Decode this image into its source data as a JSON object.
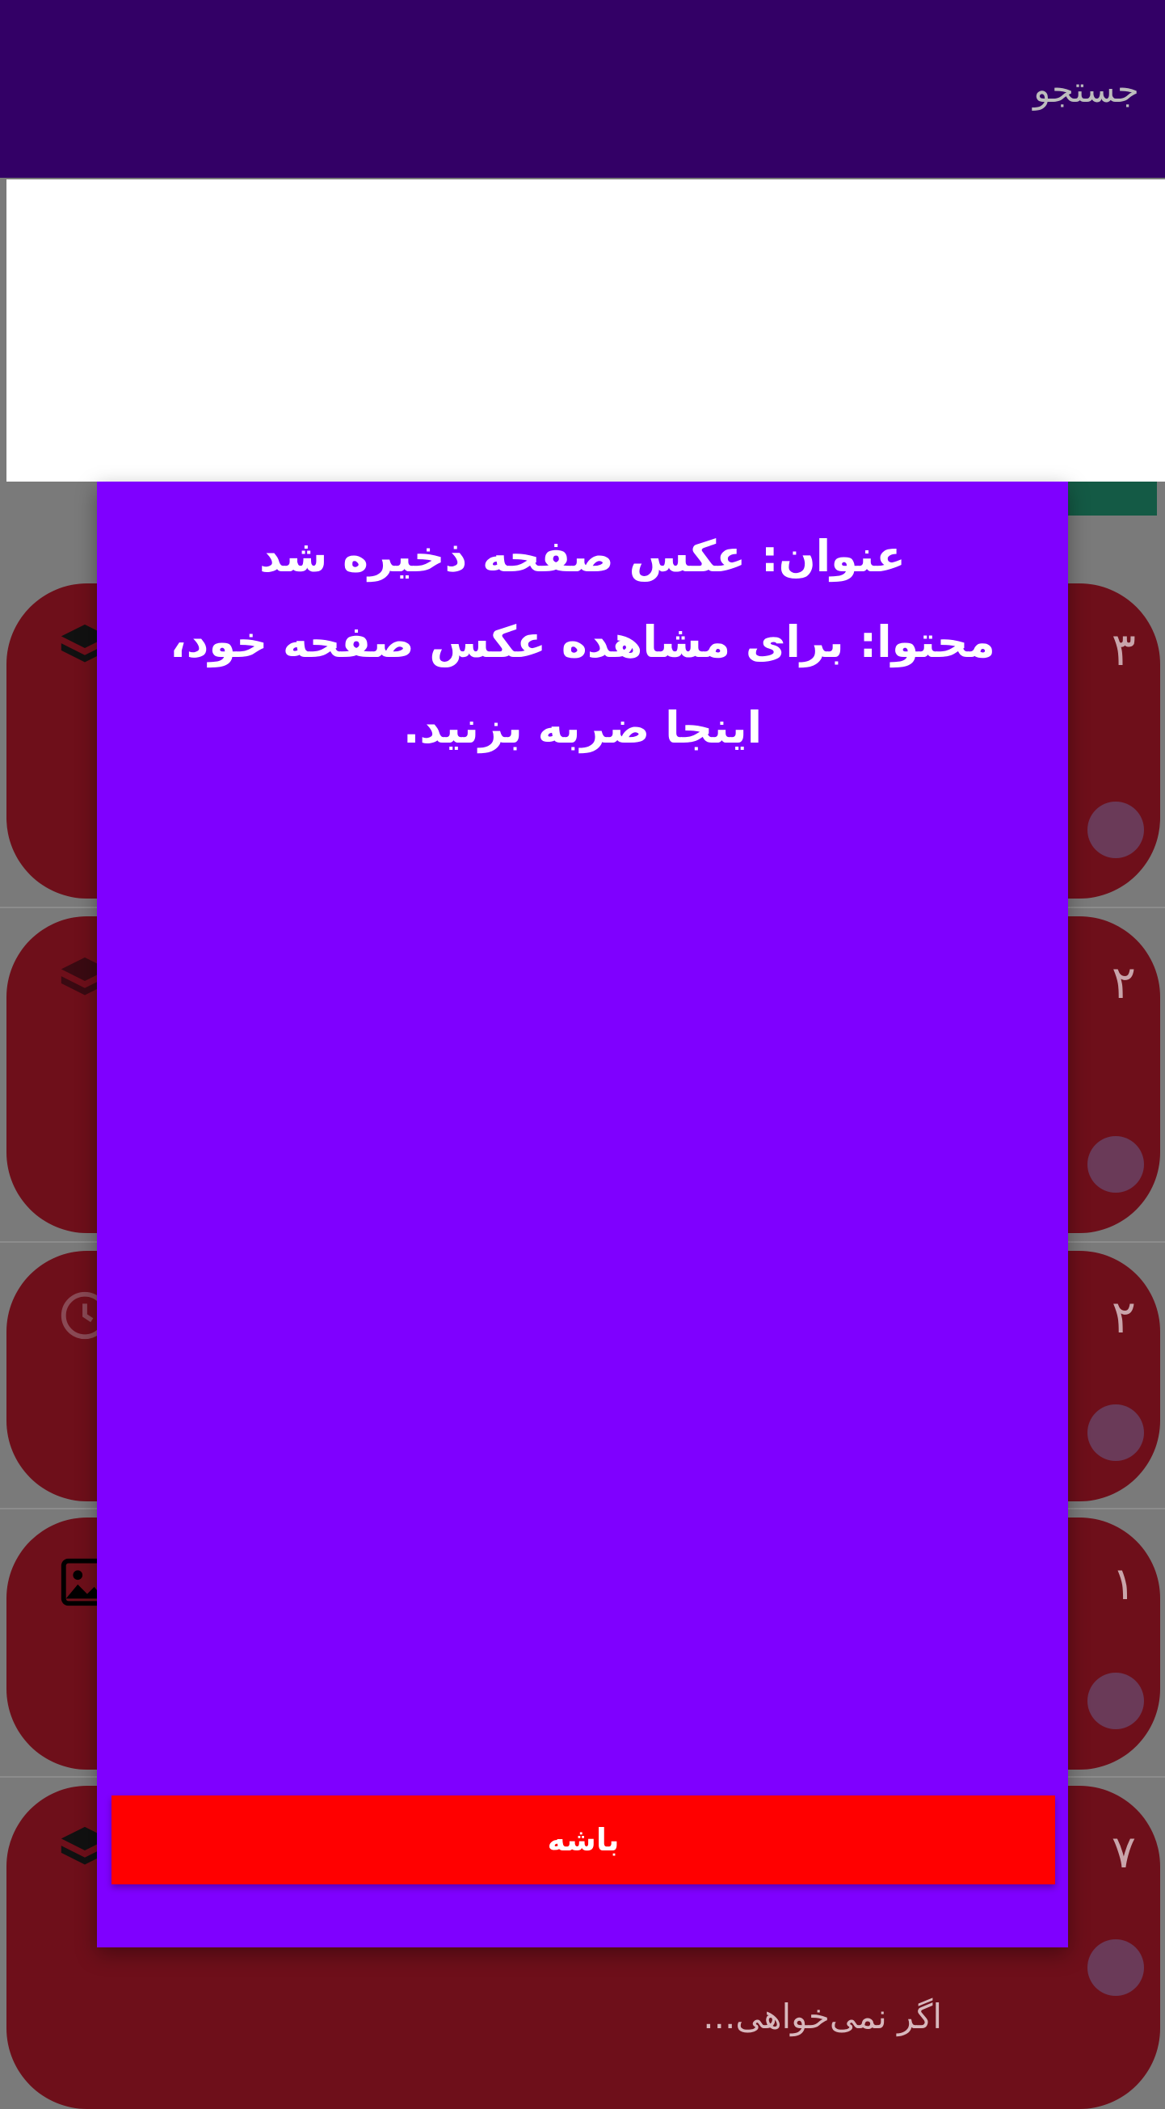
{
  "appbar": {
    "search_label": "جستجو"
  },
  "dialog": {
    "title_line": "عنوان: عکس صفحه ذخیره شد",
    "content_line": "محتوا: برای مشاهده عکس صفحه خود، اینجا ضربه بزنید.",
    "ok_label": "باشه"
  },
  "cards": [
    {
      "badge": "۳",
      "icon": "layers-icon"
    },
    {
      "badge": "۲",
      "icon": "layers-icon"
    },
    {
      "badge": "۲",
      "icon": "history-icon"
    },
    {
      "badge": "۱",
      "icon": "image-icon"
    },
    {
      "badge": "۷",
      "icon": "layers-icon",
      "note": "اگر نمی‌خواهی..."
    }
  ],
  "colors": {
    "appbar": "#330066",
    "dialog": "#7f00ff",
    "button": "#ff0000",
    "card": "#6e0f1a"
  }
}
